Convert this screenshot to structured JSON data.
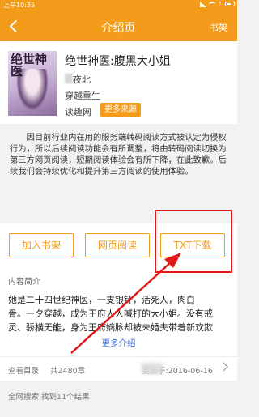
{
  "status_bar": {
    "time": "上午10:35"
  },
  "header": {
    "title": "介绍页",
    "shelf_label": "书架"
  },
  "book": {
    "cover_title": "绝世神医",
    "title": "绝世神医:腹黑大小姐",
    "author": "夜北",
    "genre": "穿越重生",
    "source": "读趣网",
    "more_sources": "更多来源"
  },
  "notice": "因目前行业内在用的服务端转码阅读方式被认定为侵权行为，所以后续阅读功能会有所调整，将由转码阅读切换为第三方网页阅读，短期阅读体验会有所下降，在此致歉。后续我们会持续优化和提升第三方阅读的使用体验。",
  "actions": {
    "add_shelf": "加入书架",
    "web_read": "网页阅读",
    "txt_download": "TXT下载"
  },
  "intro": {
    "label": "内容简介",
    "lines": [
      "她是二十四世纪神医，一支银针，活死人，肉白",
      "骨。一夕穿越，成为王府人人喊打的大小姐。没有戒",
      "灵、骄横无能，身为王府嫡脉却被未婚夫带着新欢欺"
    ],
    "more": "更多介绍"
  },
  "toc": {
    "label": "查看目录",
    "chapters": "共2480章",
    "updated": "更新于:2016-06-16"
  },
  "search_results": "全网搜索 找到11个结果",
  "colors": {
    "accent": "#f39c1c",
    "annotation": "#e0191a",
    "link": "#3f6fd8"
  }
}
